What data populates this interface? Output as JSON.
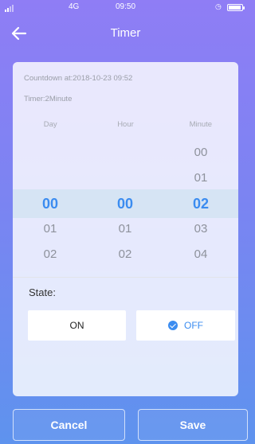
{
  "status_bar": {
    "network": "4G",
    "time": "09:50",
    "alarm_icon": "alarm-clock-icon",
    "battery_icon": "battery-icon"
  },
  "header": {
    "title": "Timer",
    "back_icon": "arrow-left-icon"
  },
  "info": {
    "countdown": "Countdown at:2018-10-23 09:52",
    "timer": "Timer:2Minute"
  },
  "picker": {
    "columns": [
      {
        "header": "Day",
        "items": [
          "",
          "",
          "00",
          "01",
          "02"
        ],
        "selected_index": 2
      },
      {
        "header": "Hour",
        "items": [
          "",
          "",
          "00",
          "01",
          "02"
        ],
        "selected_index": 2
      },
      {
        "header": "Minute",
        "items": [
          "00",
          "01",
          "02",
          "03",
          "04"
        ],
        "selected_index": 2
      }
    ]
  },
  "state": {
    "label": "State:",
    "on_label": "ON",
    "off_label": "OFF",
    "selected": "OFF",
    "check_icon": "check-circle-icon"
  },
  "footer": {
    "cancel_label": "Cancel",
    "save_label": "Save"
  },
  "colors": {
    "accent": "#3b8cf0",
    "selected_band": "#d6e4f4",
    "gradient_top": "#8f7df5",
    "gradient_bottom": "#5e93ee"
  }
}
